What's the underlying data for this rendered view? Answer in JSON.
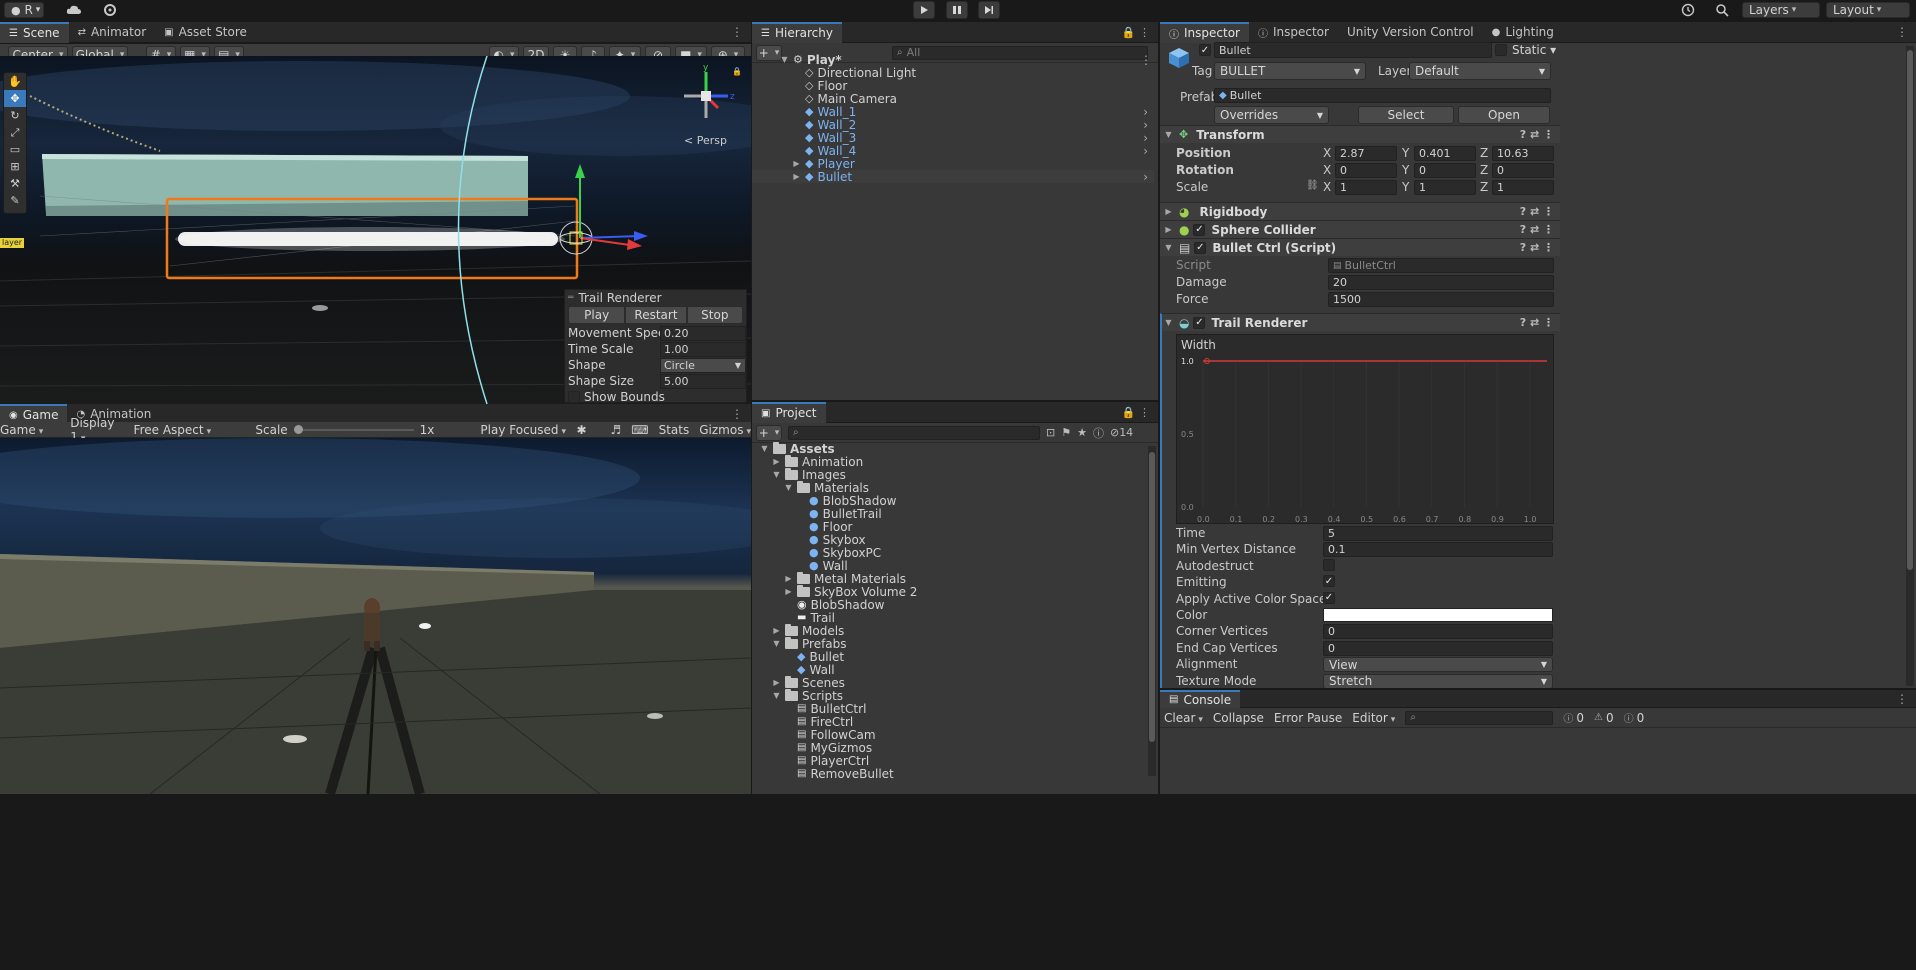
{
  "topbar": {
    "account": "R",
    "layers": "Layers",
    "layout": "Layout"
  },
  "scene_panel": {
    "tabs": [
      "Scene",
      "Animator",
      "Asset Store"
    ],
    "pivot": "Center",
    "space": "Global",
    "mode_2d": "2D",
    "persp_label": "Persp",
    "player_tag": "layer",
    "overlay": {
      "title": "Trail Renderer",
      "buttons": [
        "Play",
        "Restart",
        "Stop"
      ],
      "rows": [
        {
          "label": "Movement Speed",
          "value": "0.20"
        },
        {
          "label": "Time Scale",
          "value": "1.00"
        },
        {
          "label": "Shape",
          "value": "Circle"
        },
        {
          "label": "Shape Size",
          "value": "5.00"
        }
      ],
      "show_bounds": "Show Bounds"
    }
  },
  "game_panel": {
    "tabs": [
      "Game",
      "Animation"
    ],
    "mode": "Game",
    "display": "Display 1",
    "aspect": "Free Aspect",
    "scale_label": "Scale",
    "scale_value": "1x",
    "play_focused": "Play Focused",
    "stats": "Stats",
    "gizmos": "Gizmos"
  },
  "hierarchy": {
    "tab": "Hierarchy",
    "search_placeholder": "All",
    "root": "Play*",
    "items": [
      "Directional Light",
      "Floor",
      "Main Camera",
      "Wall_1",
      "Wall_2",
      "Wall_3",
      "Wall_4",
      "Player",
      "Bullet"
    ]
  },
  "project": {
    "tab": "Project",
    "count": "14",
    "tree": [
      {
        "name": "Assets",
        "depth": 0,
        "type": "folder",
        "open": true
      },
      {
        "name": "Animation",
        "depth": 1,
        "type": "folder",
        "open": false
      },
      {
        "name": "Images",
        "depth": 1,
        "type": "folder",
        "open": true
      },
      {
        "name": "Materials",
        "depth": 2,
        "type": "folder",
        "open": true
      },
      {
        "name": "BlobShadow",
        "depth": 3,
        "type": "material"
      },
      {
        "name": "BulletTrail",
        "depth": 3,
        "type": "material"
      },
      {
        "name": "Floor",
        "depth": 3,
        "type": "material"
      },
      {
        "name": "Skybox",
        "depth": 3,
        "type": "material"
      },
      {
        "name": "SkyboxPC",
        "depth": 3,
        "type": "material"
      },
      {
        "name": "Wall",
        "depth": 3,
        "type": "material"
      },
      {
        "name": "Metal Materials",
        "depth": 2,
        "type": "folder",
        "open": false
      },
      {
        "name": "SkyBox Volume 2",
        "depth": 2,
        "type": "folder",
        "open": false
      },
      {
        "name": "BlobShadow",
        "depth": 2,
        "type": "texture"
      },
      {
        "name": "Trail",
        "depth": 2,
        "type": "texture2"
      },
      {
        "name": "Models",
        "depth": 1,
        "type": "folder",
        "open": false
      },
      {
        "name": "Prefabs",
        "depth": 1,
        "type": "folder",
        "open": true
      },
      {
        "name": "Bullet",
        "depth": 2,
        "type": "prefab"
      },
      {
        "name": "Wall",
        "depth": 2,
        "type": "prefab"
      },
      {
        "name": "Scenes",
        "depth": 1,
        "type": "folder",
        "open": false
      },
      {
        "name": "Scripts",
        "depth": 1,
        "type": "folder",
        "open": true
      },
      {
        "name": "BulletCtrl",
        "depth": 2,
        "type": "script"
      },
      {
        "name": "FireCtrl",
        "depth": 2,
        "type": "script"
      },
      {
        "name": "FollowCam",
        "depth": 2,
        "type": "script"
      },
      {
        "name": "MyGizmos",
        "depth": 2,
        "type": "script"
      },
      {
        "name": "PlayerCtrl",
        "depth": 2,
        "type": "script"
      },
      {
        "name": "RemoveBullet",
        "depth": 2,
        "type": "script"
      }
    ]
  },
  "inspector": {
    "tabs": [
      "Inspector",
      "Inspector",
      "Unity Version Control",
      "Lighting"
    ],
    "object_name": "Bullet",
    "static": "Static",
    "tag_label": "Tag",
    "tag": "BULLET",
    "layer_label": "Layer",
    "layer": "Default",
    "prefab_label": "Prefab",
    "prefab_name": "Bullet",
    "overrides": "Overrides",
    "select": "Select",
    "open": "Open",
    "transform": {
      "title": "Transform",
      "position": {
        "label": "Position",
        "x": "2.87",
        "y": "0.401",
        "z": "10.63"
      },
      "rotation": {
        "label": "Rotation",
        "x": "0",
        "y": "0",
        "z": "0"
      },
      "scale": {
        "label": "Scale",
        "x": "1",
        "y": "1",
        "z": "1"
      }
    },
    "components": [
      "Rigidbody",
      "Sphere Collider",
      "Bullet Ctrl (Script)"
    ],
    "script": {
      "label": "Script",
      "value": "BulletCtrl"
    },
    "damage": {
      "label": "Damage",
      "value": "20"
    },
    "force": {
      "label": "Force",
      "value": "1500"
    },
    "trail": {
      "title": "Trail Renderer",
      "width_label": "Width",
      "curve_y_ticks": [
        "1.0",
        "0.5",
        "0.0"
      ],
      "curve_x_ticks": [
        "0.0",
        "0.1",
        "0.2",
        "0.3",
        "0.4",
        "0.5",
        "0.6",
        "0.7",
        "0.8",
        "0.9",
        "1.0"
      ],
      "props": [
        {
          "label": "Time",
          "value": "5",
          "kind": "field"
        },
        {
          "label": "Min Vertex Distance",
          "value": "0.1",
          "kind": "field"
        },
        {
          "label": "Autodestruct",
          "value": "",
          "kind": "check-off"
        },
        {
          "label": "Emitting",
          "value": "",
          "kind": "check-on"
        },
        {
          "label": "Apply Active Color Space",
          "value": "",
          "kind": "check-on"
        },
        {
          "label": "Color",
          "value": "",
          "kind": "color"
        },
        {
          "label": "Corner Vertices",
          "value": "0",
          "kind": "field"
        },
        {
          "label": "End Cap Vertices",
          "value": "0",
          "kind": "field"
        },
        {
          "label": "Alignment",
          "value": "View",
          "kind": "select"
        },
        {
          "label": "Texture Mode",
          "value": "Stretch",
          "kind": "select"
        }
      ]
    }
  },
  "console": {
    "tab": "Console",
    "clear": "Clear",
    "collapse": "Collapse",
    "error_pause": "Error Pause",
    "editor": "Editor",
    "counts": [
      "0",
      "0",
      "0"
    ]
  },
  "colors": {
    "accent": "#3a79bb",
    "selection": "#f07a1a",
    "prefab_blue": "#7cb3f0"
  }
}
